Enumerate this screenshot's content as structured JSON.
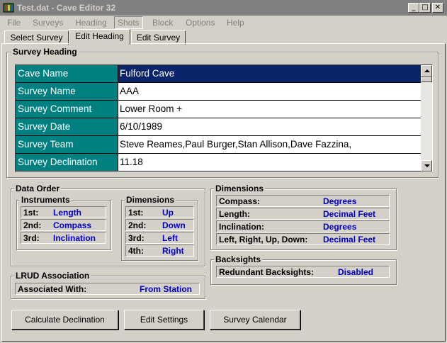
{
  "window": {
    "title": "Test.dat - Cave Editor 32"
  },
  "menu": [
    {
      "label": "File"
    },
    {
      "label": "Surveys"
    },
    {
      "label": "Heading"
    },
    {
      "label": "Shots"
    },
    {
      "label": "Block"
    },
    {
      "label": "Options"
    },
    {
      "label": "Help"
    }
  ],
  "tabs": [
    {
      "label": "Select Survey"
    },
    {
      "label": "Edit Heading"
    },
    {
      "label": "Edit Survey"
    }
  ],
  "survey_heading": {
    "title": "Survey Heading",
    "rows": [
      {
        "label": "Cave Name",
        "value": "Fulford Cave"
      },
      {
        "label": "Survey Name",
        "value": "AAA"
      },
      {
        "label": "Survey Comment",
        "value": "Lower Room +"
      },
      {
        "label": "Survey Date",
        "value": "6/10/1989"
      },
      {
        "label": "Survey Team",
        "value": "Steve Reames,Paul Burger,Stan Allison,Dave Fazzina,"
      },
      {
        "label": "Survey Declination",
        "value": "11.18"
      }
    ]
  },
  "data_order": {
    "title": "Data Order",
    "instruments": {
      "title": "Instruments",
      "rows": [
        {
          "label": "1st:",
          "value": "Length"
        },
        {
          "label": "2nd:",
          "value": "Compass"
        },
        {
          "label": "3rd:",
          "value": "Inclination"
        }
      ]
    },
    "dimensions": {
      "title": "Dimensions",
      "rows": [
        {
          "label": "1st:",
          "value": "Up"
        },
        {
          "label": "2nd:",
          "value": "Down"
        },
        {
          "label": "3rd:",
          "value": "Left"
        },
        {
          "label": "4th:",
          "value": "Right"
        }
      ]
    }
  },
  "dimensions_units": {
    "title": "Dimensions",
    "rows": [
      {
        "label": "Compass:",
        "value": "Degrees"
      },
      {
        "label": "Length:",
        "value": "Decimal Feet"
      },
      {
        "label": "Inclination:",
        "value": "Degrees"
      },
      {
        "label": "Left, Right, Up, Down:",
        "value": "Decimal Feet"
      }
    ]
  },
  "backsights": {
    "title": "Backsights",
    "label": "Redundant Backsights:",
    "value": "Disabled"
  },
  "lrud": {
    "title": "LRUD Association",
    "label": "Associated With:",
    "value": "From Station"
  },
  "buttons": {
    "calculate": "Calculate Declination",
    "settings": "Edit Settings",
    "calendar": "Survey Calendar"
  },
  "colors": {
    "label_cell": "#008080",
    "selection": "#0a246a",
    "value_text": "#0000c8"
  }
}
